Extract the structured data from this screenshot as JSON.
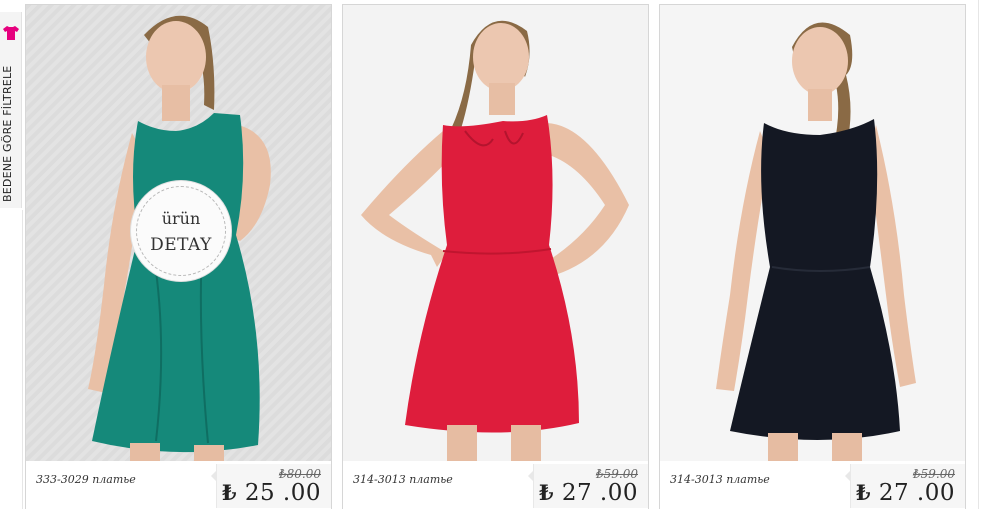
{
  "filter_tab": {
    "label": "BEDENE GÖRE FİLTRELE",
    "icon": "shirt-icon",
    "icon_color": "#e6007e"
  },
  "detail_badge": {
    "line1": "ürün",
    "line2": "DETAY"
  },
  "products": [
    {
      "code": "333-3029 платье",
      "old_price": "₺80.00",
      "currency": "₺",
      "price": "25 .00",
      "dress_color": "#15897a",
      "background": "#e2e2e2"
    },
    {
      "code": "314-3013 платье",
      "old_price": "₺59.00",
      "currency": "₺",
      "price": "27 .00",
      "dress_color": "#de1d3c",
      "background": "#f3f3f3"
    },
    {
      "code": "314-3013 платье",
      "old_price": "₺59.00",
      "currency": "₺",
      "price": "27 .00",
      "dress_color": "#141823",
      "background": "#f5f5f5"
    }
  ]
}
